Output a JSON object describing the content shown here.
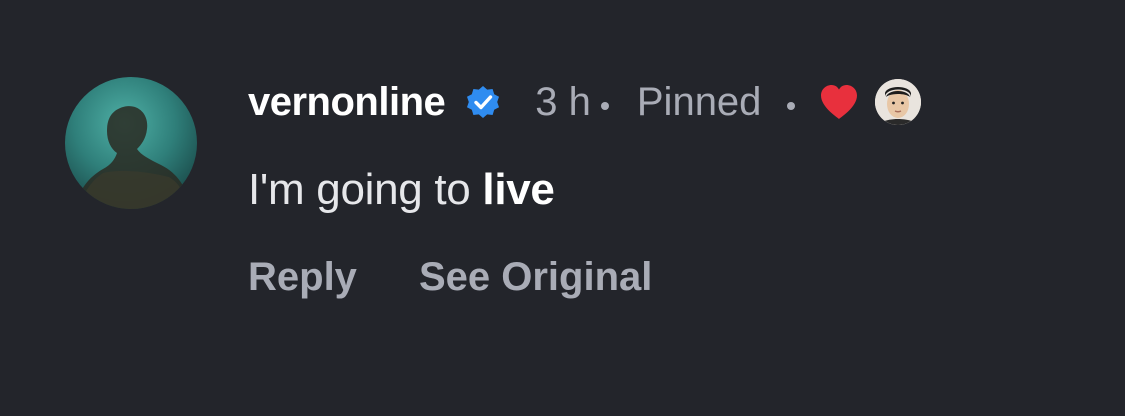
{
  "comment": {
    "username": "vernonline",
    "verified_icon": "verified-badge-icon",
    "time": "3 h",
    "pinned_label": "Pinned",
    "liked_by_creator_icon": "heart-icon",
    "text_prefix": "I'm going to ",
    "text_emphasis": "live",
    "actions": {
      "reply_label": "Reply",
      "see_original_label": "See Original"
    }
  },
  "colors": {
    "background": "#23252b",
    "username": "#ffffff",
    "meta": "#a9acb6",
    "verified": "#2f8cf0",
    "heart": "#e8303d"
  }
}
